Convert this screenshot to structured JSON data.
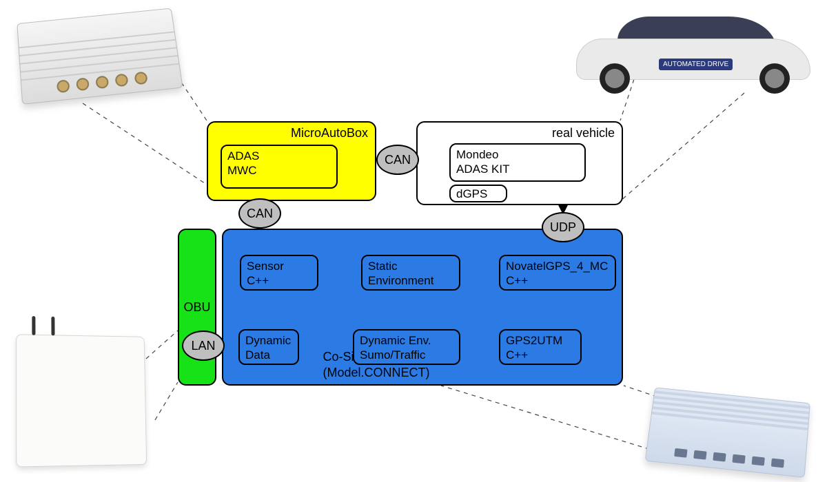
{
  "microautobox": {
    "title": "MicroAutoBox",
    "inner": {
      "line1": "ADAS",
      "line2": "MWC"
    },
    "color": "#ffff00"
  },
  "real_vehicle": {
    "title": "real vehicle",
    "inner": {
      "line1": "Mondeo",
      "line2": "ADAS KIT"
    },
    "dgps": "dGPS"
  },
  "obu": {
    "label": "OBU",
    "color": "#17e217"
  },
  "cosim": {
    "title": "Co-Simulation Platform (Model.CONNECT)",
    "color": "#2c7be5",
    "sensor": {
      "line1": "Sensor",
      "line2": "C++"
    },
    "static_env": {
      "line1": "Static",
      "line2": "Environment"
    },
    "novatel": {
      "line1": "NovatelGPS_4_MC",
      "line2": "C++"
    },
    "dyn_data": {
      "line1": "Dynamic",
      "line2": "Data"
    },
    "dyn_env": {
      "line1": "Dynamic Env.",
      "line2": "Sumo/Traffic"
    },
    "gps2utm": {
      "line1": "GPS2UTM",
      "line2": "C++"
    }
  },
  "protocols": {
    "can_top": "CAN",
    "can_left": "CAN",
    "udp": "UDP",
    "lan": "LAN"
  },
  "hardware": {
    "top_left": "MicroAutoBox-device",
    "top_right": "vehicle",
    "bottom_left": "OBU-device",
    "bottom_right": "industrial-PC"
  },
  "car_badge": "AUTOMATED DRIVE"
}
